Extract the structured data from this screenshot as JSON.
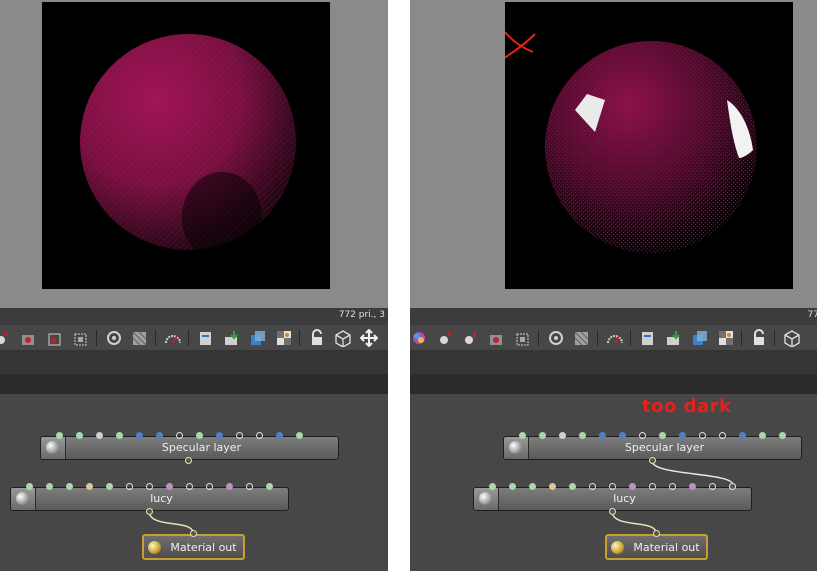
{
  "left": {
    "status": "772 pri., 3",
    "nodes": {
      "specular": "Specular layer",
      "lucy": "lucy",
      "out": "Material out"
    }
  },
  "right": {
    "status": "77",
    "annotation": "too dark",
    "nodes": {
      "specular": "Specular layer",
      "lucy": "lucy",
      "out": "Material out"
    }
  },
  "colors": {
    "viewport_gray": "#8a8a8a",
    "sphere": "#b0185a",
    "annotation_red": "#e8201a",
    "output_border": "#c8a030"
  },
  "icons": [
    "material-icon",
    "spray-icon",
    "texture-icon",
    "frame-icon",
    "camera-icon",
    "pattern-icon",
    "gauge-icon",
    "clipboard-icon",
    "import-icon",
    "layers-icon",
    "checker-icon",
    "lock-icon",
    "box-icon",
    "move-icon",
    "rotate-icon"
  ]
}
